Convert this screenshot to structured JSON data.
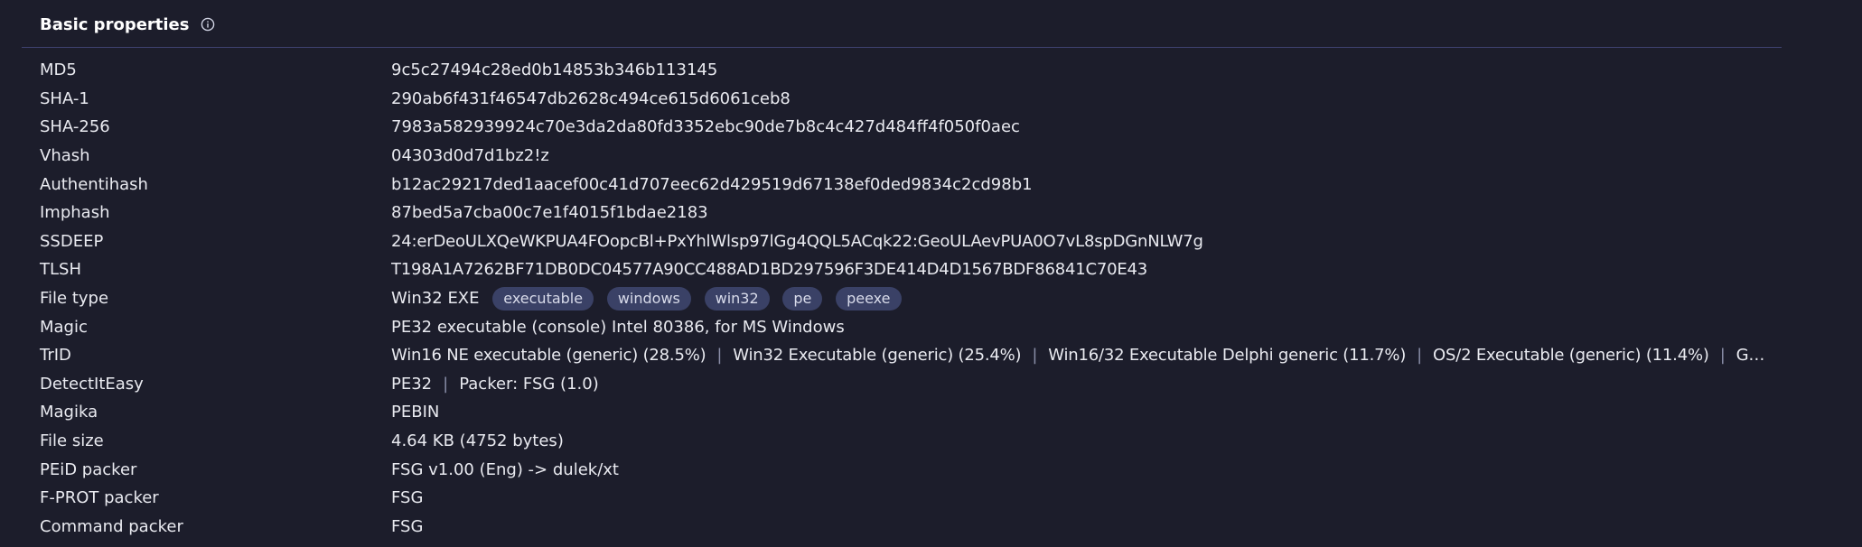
{
  "section": {
    "title": "Basic properties",
    "info_icon": "info-circle-icon"
  },
  "rows": {
    "md5": {
      "label": "MD5",
      "value": "9c5c27494c28ed0b14853b346b113145"
    },
    "sha1": {
      "label": "SHA-1",
      "value": "290ab6f431f46547db2628c494ce615d6061ceb8"
    },
    "sha256": {
      "label": "SHA-256",
      "value": "7983a582939924c70e3da2da80fd3352ebc90de7b8c4c427d484ff4f050f0aec"
    },
    "vhash": {
      "label": "Vhash",
      "value": "04303d0d7d1bz2!z"
    },
    "authentihash": {
      "label": "Authentihash",
      "value": "b12ac29217ded1aacef00c41d707eec62d429519d67138ef0ded9834c2cd98b1"
    },
    "imphash": {
      "label": "Imphash",
      "value": "87bed5a7cba00c7e1f4015f1bdae2183"
    },
    "ssdeep": {
      "label": "SSDEEP",
      "value": "24:erDeoULXQeWKPUA4FOopcBl+PxYhlWlsp97lGg4QQL5ACqk22:GeoULAevPUA0O7vL8spDGnNLW7g"
    },
    "tlsh": {
      "label": "TLSH",
      "value": "T198A1A7262BF71DB0DC04577A90CC488AD1BD297596F3DE414D4D1567BDF86841C70E43"
    },
    "file_type": {
      "label": "File type",
      "value": "Win32 EXE",
      "tags": [
        "executable",
        "windows",
        "win32",
        "pe",
        "peexe"
      ]
    },
    "magic": {
      "label": "Magic",
      "value": "PE32 executable (console) Intel 80386, for MS Windows"
    },
    "trid": {
      "label": "TrID",
      "entries": [
        "Win16 NE executable (generic) (28.5%)",
        "Win32 Executable (generic) (25.4%)",
        "Win16/32 Executable Delphi generic (11.7%)",
        "OS/2 Executable (generic) (11.4%)",
        "Gener…"
      ]
    },
    "die": {
      "label": "DetectItEasy",
      "entries": [
        "PE32",
        "Packer: FSG (1.0)"
      ]
    },
    "magika": {
      "label": "Magika",
      "value": "PEBIN"
    },
    "file_size": {
      "label": "File size",
      "value": "4.64 KB (4752 bytes)"
    },
    "peid": {
      "label": "PEiD packer",
      "value": "FSG v1.00 (Eng) -> dulek/xt"
    },
    "fprot": {
      "label": "F-PROT packer",
      "value": "FSG"
    },
    "command": {
      "label": "Command packer",
      "value": "FSG"
    }
  },
  "colors": {
    "background": "#1c1d2b",
    "divider": "#3e4270",
    "tag_bg": "#3a4166",
    "text": "#e9eaf0"
  }
}
